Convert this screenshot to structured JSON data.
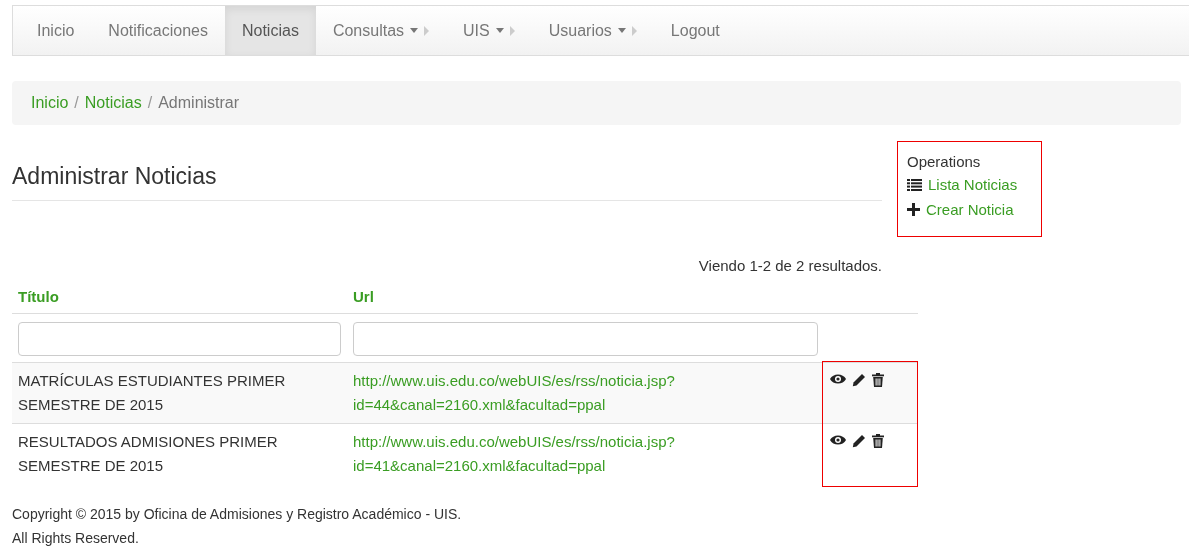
{
  "navbar": {
    "items": [
      {
        "label": "Inicio",
        "kind": "link",
        "selected": false
      },
      {
        "label": "Notificaciones",
        "kind": "link",
        "selected": false
      },
      {
        "label": "Noticias",
        "kind": "link",
        "selected": true
      },
      {
        "label": "Consultas",
        "kind": "dropdown",
        "selected": false
      },
      {
        "label": "UIS",
        "kind": "dropdown",
        "selected": false
      },
      {
        "label": "Usuarios",
        "kind": "dropdown",
        "selected": false
      },
      {
        "label": "Logout",
        "kind": "link",
        "selected": false
      }
    ]
  },
  "breadcrumb": {
    "links": [
      "Inicio",
      "Noticias"
    ],
    "current": "Administrar",
    "separator": "/"
  },
  "page_title": "Administrar Noticias",
  "operations": {
    "title": "Operations",
    "highlighted": true,
    "items": [
      {
        "label": "Lista Noticias",
        "kind": "list"
      },
      {
        "label": "Crear Noticia",
        "kind": "create"
      }
    ]
  },
  "summary": "Viendo 1-2 de 2 resultados.",
  "table": {
    "columns": [
      "Título",
      "Url"
    ],
    "actions_highlighted": true,
    "rows": [
      {
        "title": "MATRÍCULAS ESTUDIANTES PRIMER SEMESTRE DE 2015",
        "url": "http://www.uis.edu.co/webUIS/es/rss/noticia.jsp?id=44&canal=2160.xml&facultad=ppal"
      },
      {
        "title": "RESULTADOS ADMISIONES PRIMER SEMESTRE DE 2015",
        "url": "http://www.uis.edu.co/webUIS/es/rss/noticia.jsp?id=41&canal=2160.xml&facultad=ppal"
      }
    ]
  },
  "footer": [
    "Copyright © 2015 by Oficina de Admisiones y Registro Académico - UIS.",
    "All Rights Reserved."
  ]
}
